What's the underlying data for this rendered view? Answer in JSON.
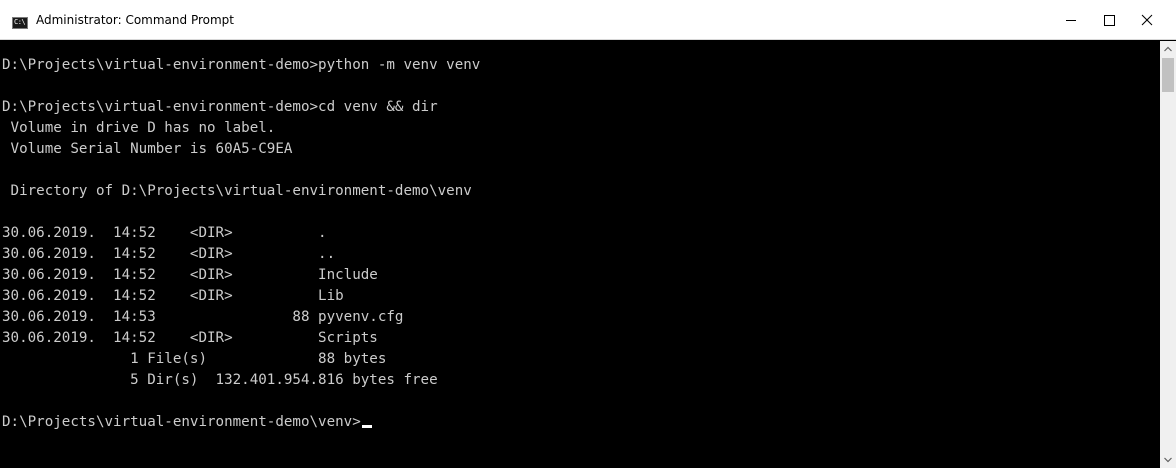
{
  "window": {
    "title": "Administrator: Command Prompt",
    "icon_text": "C:\\",
    "buttons": {
      "minimize": "minimize-icon",
      "maximize": "maximize-icon",
      "close": "close-icon"
    }
  },
  "console": {
    "lines": [
      "D:\\Projects\\virtual-environment-demo>python -m venv venv",
      "",
      "D:\\Projects\\virtual-environment-demo>cd venv && dir",
      " Volume in drive D has no label.",
      " Volume Serial Number is 60A5-C9EA",
      "",
      " Directory of D:\\Projects\\virtual-environment-demo\\venv",
      "",
      "30.06.2019.  14:52    <DIR>          .",
      "30.06.2019.  14:52    <DIR>          ..",
      "30.06.2019.  14:52    <DIR>          Include",
      "30.06.2019.  14:52    <DIR>          Lib",
      "30.06.2019.  14:53                88 pyvenv.cfg",
      "30.06.2019.  14:52    <DIR>          Scripts",
      "               1 File(s)             88 bytes",
      "               5 Dir(s)  132.401.954.816 bytes free",
      "",
      "D:\\Projects\\virtual-environment-demo\\venv>"
    ]
  },
  "colors": {
    "console_bg": "#000000",
    "console_fg": "#cccccc",
    "titlebar_bg": "#ffffff",
    "scrollbar_bg": "#f0f0f0",
    "scrollbar_thumb": "#c1c1c1"
  }
}
